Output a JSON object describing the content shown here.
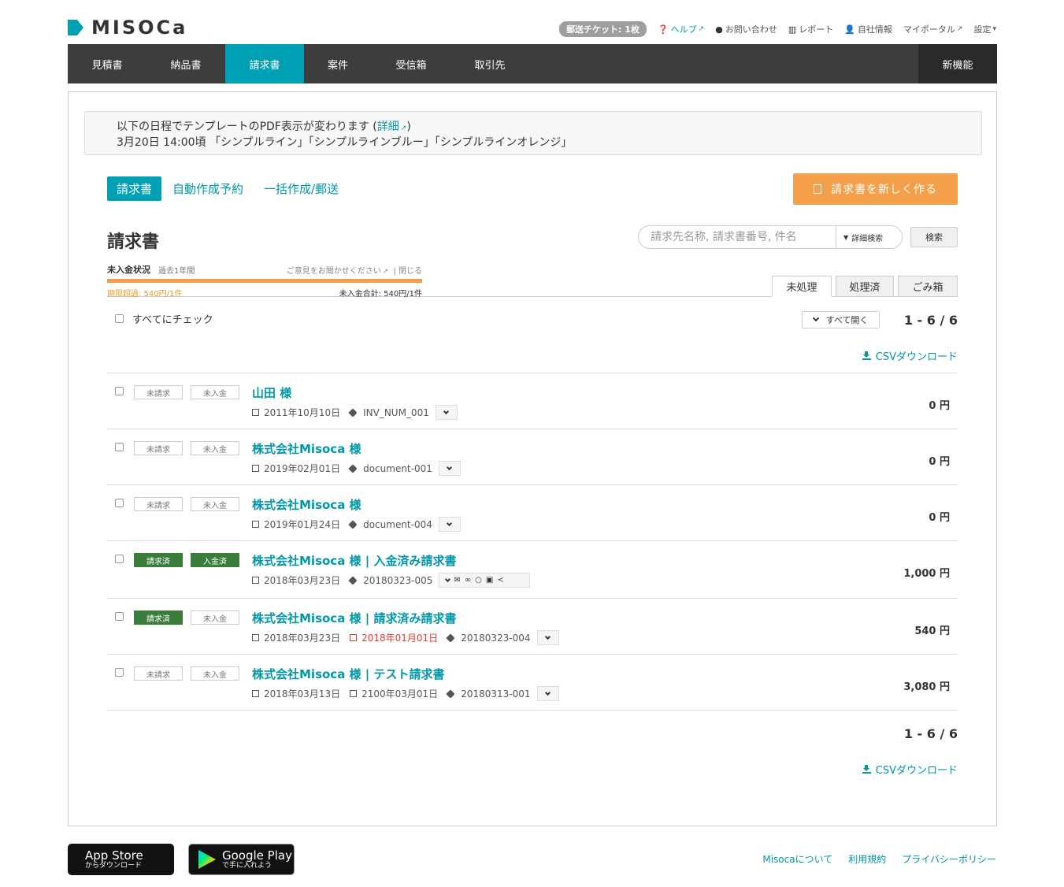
{
  "brand": {
    "name": "MISOCa"
  },
  "util": {
    "ticket": "郵送チケット: 1枚",
    "help": "ヘルプ",
    "contact": "お問い合わせ",
    "report": "レポート",
    "company": "自社情報",
    "portal": "マイポータル",
    "settings": "設定"
  },
  "nav": {
    "items": [
      {
        "label": "見積書"
      },
      {
        "label": "納品書"
      },
      {
        "label": "請求書"
      },
      {
        "label": "案件"
      },
      {
        "label": "受信箱"
      },
      {
        "label": "取引先"
      }
    ],
    "active_index": 2,
    "new_features": "新機能"
  },
  "notice": {
    "line1_prefix": "以下の日程でテンプレートのPDF表示が変わります (",
    "link": "詳細",
    "line1_suffix": ")",
    "line2": "3月20日 14:00頃 「シンプルライン」「シンプルラインブルー」「シンプルラインオレンジ」"
  },
  "subtabs": {
    "invoice": "請求書",
    "auto": "自動作成予約",
    "bulk": "一括作成/郵送"
  },
  "new_button": "請求書を新しく作る",
  "page_title": "請求書",
  "search": {
    "placeholder": "請求先名称, 請求書番号, 件名",
    "advanced": "詳細検索",
    "button": "検索"
  },
  "status": {
    "title": "未入金状況",
    "period": "過去1年間",
    "feedback": "ご意見をお聞かせください",
    "close": "| 閉じる",
    "overdue": "期限超過: 540円/1件",
    "total": "未入金合計: 540円/1件"
  },
  "filter_tabs": {
    "pending": "未処理",
    "done": "処理済",
    "trash": "ごみ箱"
  },
  "check_all": "すべてにチェック",
  "open_all": "すべて開く",
  "count": "1 - 6 / 6",
  "csv": "CSVダウンロード",
  "invoices": [
    {
      "billed": "未請求",
      "paid": "未入金",
      "billed_on": false,
      "paid_on": false,
      "title": "山田 様",
      "date": "2011年10月10日",
      "due": "",
      "number": "INV_NUM_001",
      "amount": "0 円"
    },
    {
      "billed": "未請求",
      "paid": "未入金",
      "billed_on": false,
      "paid_on": false,
      "title": "株式会社Misoca 様",
      "date": "2019年02月01日",
      "due": "",
      "number": "document-001",
      "amount": "0 円"
    },
    {
      "billed": "未請求",
      "paid": "未入金",
      "billed_on": false,
      "paid_on": false,
      "title": "株式会社Misoca 様",
      "date": "2019年01月24日",
      "due": "",
      "number": "document-004",
      "amount": "0 円"
    },
    {
      "billed": "請求済",
      "paid": "入金済",
      "billed_on": true,
      "paid_on": true,
      "title": "株式会社Misoca 様 | 入金済み請求書",
      "date": "2018年03月23日",
      "due": "",
      "number": "20180323-005",
      "amount": "1,000 円"
    },
    {
      "billed": "請求済",
      "paid": "未入金",
      "billed_on": true,
      "paid_on": false,
      "title": "株式会社Misoca 様 | 請求済み請求書",
      "date": "2018年03月23日",
      "due": "2018年01月01日",
      "due_overdue": true,
      "number": "20180323-004",
      "amount": "540 円"
    },
    {
      "billed": "未請求",
      "paid": "未入金",
      "billed_on": false,
      "paid_on": false,
      "title": "株式会社Misoca 様 | テスト請求書",
      "date": "2018年03月13日",
      "due": "2100年03月01日",
      "number": "20180313-001",
      "amount": "3,080 円"
    }
  ],
  "footer": {
    "apple_big": "App Store",
    "apple_small": "からダウンロード",
    "google_big": "Google Play",
    "google_small": "で手に入れよう",
    "links": [
      "Misocaについて",
      "利用規約",
      "プライバシーポリシー"
    ]
  },
  "colors": {
    "accent": "#00a0b4",
    "orange": "#f4a04a",
    "paid_green": "#3a7d3a",
    "overdue_red": "#e53935"
  }
}
